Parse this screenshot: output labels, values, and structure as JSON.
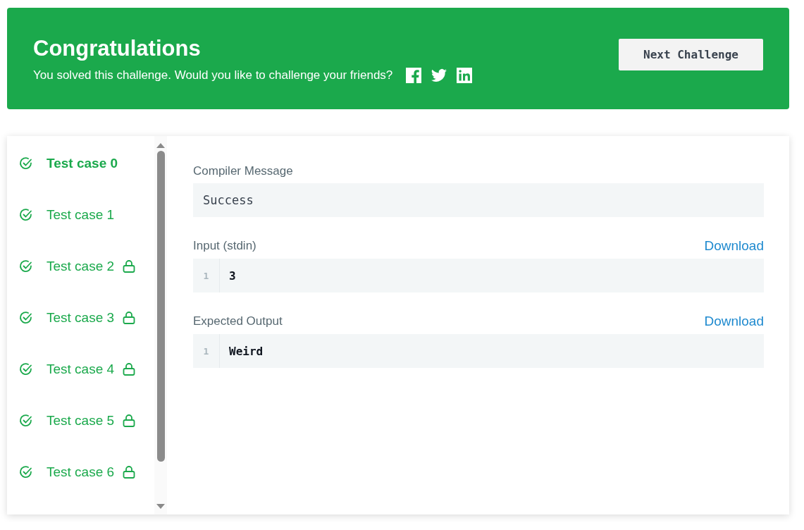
{
  "banner": {
    "title": "Congratulations",
    "message": "You solved this challenge. Would you like to challenge your friends?",
    "button": "Next Challenge"
  },
  "test_cases": [
    {
      "label": "Test case 0",
      "selected": true,
      "passed": true,
      "locked": false
    },
    {
      "label": "Test case 1",
      "selected": false,
      "passed": true,
      "locked": false
    },
    {
      "label": "Test case 2",
      "selected": false,
      "passed": true,
      "locked": true
    },
    {
      "label": "Test case 3",
      "selected": false,
      "passed": true,
      "locked": true
    },
    {
      "label": "Test case 4",
      "selected": false,
      "passed": true,
      "locked": true
    },
    {
      "label": "Test case 5",
      "selected": false,
      "passed": true,
      "locked": true
    },
    {
      "label": "Test case 6",
      "selected": false,
      "passed": true,
      "locked": true
    }
  ],
  "sections": [
    {
      "kind": "message",
      "label": "Compiler Message",
      "value": "Success"
    },
    {
      "kind": "code",
      "label": "Input (stdin)",
      "download": "Download",
      "lines": [
        {
          "number": "1",
          "text": "3"
        }
      ]
    },
    {
      "kind": "code",
      "label": "Expected Output",
      "download": "Download",
      "lines": [
        {
          "number": "1",
          "text": "Weird"
        }
      ]
    }
  ]
}
